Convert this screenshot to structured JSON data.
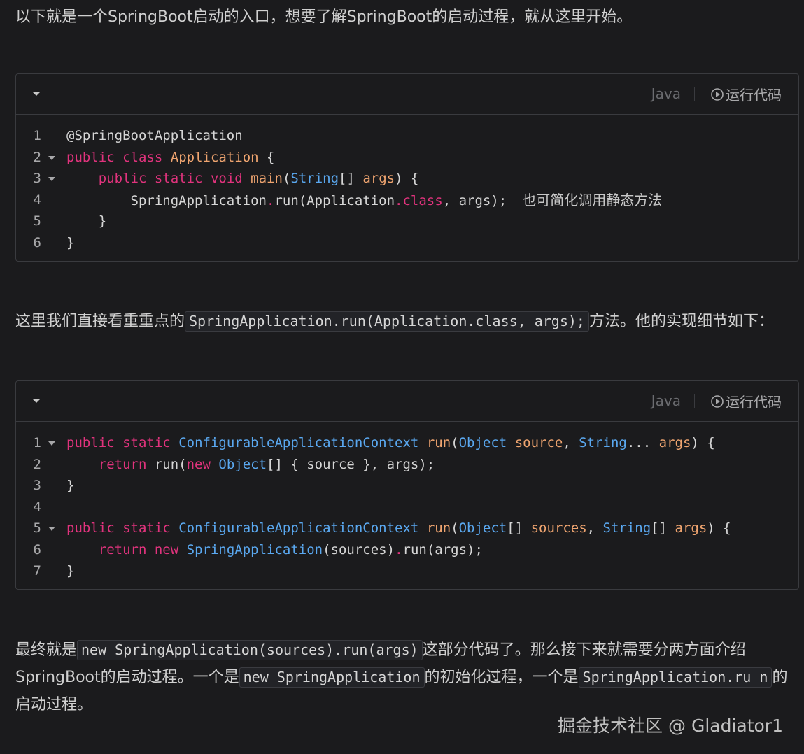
{
  "intro": {
    "text": "以下就是一个SpringBoot启动的入口，想要了解SpringBoot的启动过程，就从这里开始。"
  },
  "codeblock1": {
    "language": "Java",
    "run_label": "运行代码",
    "lines": [
      {
        "num": "1",
        "tokens": [
          [
            "",
            "@SpringBootApplication"
          ]
        ]
      },
      {
        "num": "2",
        "fold": true,
        "tokens": [
          [
            "kw",
            "public"
          ],
          [
            "",
            " "
          ],
          [
            "kw",
            "class"
          ],
          [
            "",
            " "
          ],
          [
            "fn",
            "Application"
          ],
          [
            "",
            " {"
          ]
        ]
      },
      {
        "num": "3",
        "fold": true,
        "tokens": [
          [
            "",
            "    "
          ],
          [
            "kw",
            "public"
          ],
          [
            "",
            " "
          ],
          [
            "kw",
            "static"
          ],
          [
            "",
            " "
          ],
          [
            "kw",
            "void"
          ],
          [
            "",
            " "
          ],
          [
            "fn",
            "main"
          ],
          [
            "",
            "("
          ],
          [
            "ty",
            "String"
          ],
          [
            "",
            "[] "
          ],
          [
            "pm",
            "args"
          ],
          [
            "",
            ") {"
          ]
        ]
      },
      {
        "num": "4",
        "tokens": [
          [
            "",
            "        SpringApplication"
          ],
          [
            "dot",
            "."
          ],
          [
            "",
            "run(Application"
          ],
          [
            "dot",
            "."
          ],
          [
            "kw",
            "class"
          ],
          [
            "",
            ", args);"
          ]
        ],
        "annotation": "也可简化调用静态方法"
      },
      {
        "num": "5",
        "tokens": [
          [
            "",
            "    }"
          ]
        ]
      },
      {
        "num": "6",
        "tokens": [
          [
            "",
            "}"
          ]
        ]
      }
    ]
  },
  "para2": {
    "before": "这里我们直接看重重点的",
    "code": "SpringApplication.run(Application.class, args);",
    "after": "方法。他的实现细节如下："
  },
  "codeblock2": {
    "language": "Java",
    "run_label": "运行代码",
    "lines": [
      {
        "num": "1",
        "fold": true,
        "tokens": [
          [
            "kw",
            "public"
          ],
          [
            "",
            " "
          ],
          [
            "kw",
            "static"
          ],
          [
            "",
            " "
          ],
          [
            "ty",
            "ConfigurableApplicationContext"
          ],
          [
            "",
            " "
          ],
          [
            "fn",
            "run"
          ],
          [
            "",
            "("
          ],
          [
            "ty",
            "Object"
          ],
          [
            "",
            " "
          ],
          [
            "pm",
            "source"
          ],
          [
            "",
            ", "
          ],
          [
            "ty",
            "String"
          ],
          [
            "",
            "... "
          ],
          [
            "pm",
            "args"
          ],
          [
            "",
            ") {"
          ]
        ]
      },
      {
        "num": "2",
        "tokens": [
          [
            "",
            "    "
          ],
          [
            "kw",
            "return"
          ],
          [
            "",
            " run("
          ],
          [
            "kw",
            "new"
          ],
          [
            "",
            " "
          ],
          [
            "ty",
            "Object"
          ],
          [
            "",
            "[] { source }, args);"
          ]
        ]
      },
      {
        "num": "3",
        "tokens": [
          [
            "",
            "}"
          ]
        ]
      },
      {
        "num": "4",
        "tokens": [
          [
            "",
            ""
          ]
        ]
      },
      {
        "num": "5",
        "fold": true,
        "tokens": [
          [
            "kw",
            "public"
          ],
          [
            "",
            " "
          ],
          [
            "kw",
            "static"
          ],
          [
            "",
            " "
          ],
          [
            "ty",
            "ConfigurableApplicationContext"
          ],
          [
            "",
            " "
          ],
          [
            "fn",
            "run"
          ],
          [
            "",
            "("
          ],
          [
            "ty",
            "Object"
          ],
          [
            "",
            "[] "
          ],
          [
            "pm",
            "sources"
          ],
          [
            "",
            ", "
          ],
          [
            "ty",
            "String"
          ],
          [
            "",
            "[] "
          ],
          [
            "pm",
            "args"
          ],
          [
            "",
            ") {"
          ]
        ]
      },
      {
        "num": "6",
        "tokens": [
          [
            "",
            "    "
          ],
          [
            "kw",
            "return"
          ],
          [
            "",
            " "
          ],
          [
            "kw",
            "new"
          ],
          [
            "",
            " "
          ],
          [
            "ty",
            "SpringApplication"
          ],
          [
            "",
            "(sources)"
          ],
          [
            "dot",
            "."
          ],
          [
            "",
            "run(args);"
          ]
        ]
      },
      {
        "num": "7",
        "tokens": [
          [
            "",
            "}"
          ]
        ]
      }
    ]
  },
  "para3": {
    "part1": "最终就是",
    "code1": "new SpringApplication(sources).run(args)",
    "part2": "这部分代码了。那么接下来就需要分两方面介绍SpringBoot的启动过程。一个是",
    "code2": "new SpringApplication",
    "part3": "的初始化过程，一个是",
    "code3": "SpringApplication.ru n",
    "part4": "的启动过程。"
  },
  "watermark": {
    "text": "掘金技术社区 @ Gladiator1"
  },
  "colors": {
    "background": "#1b1b1d",
    "keyword": "#e1337d",
    "type": "#5aa8f0",
    "function": "#f0a570"
  }
}
